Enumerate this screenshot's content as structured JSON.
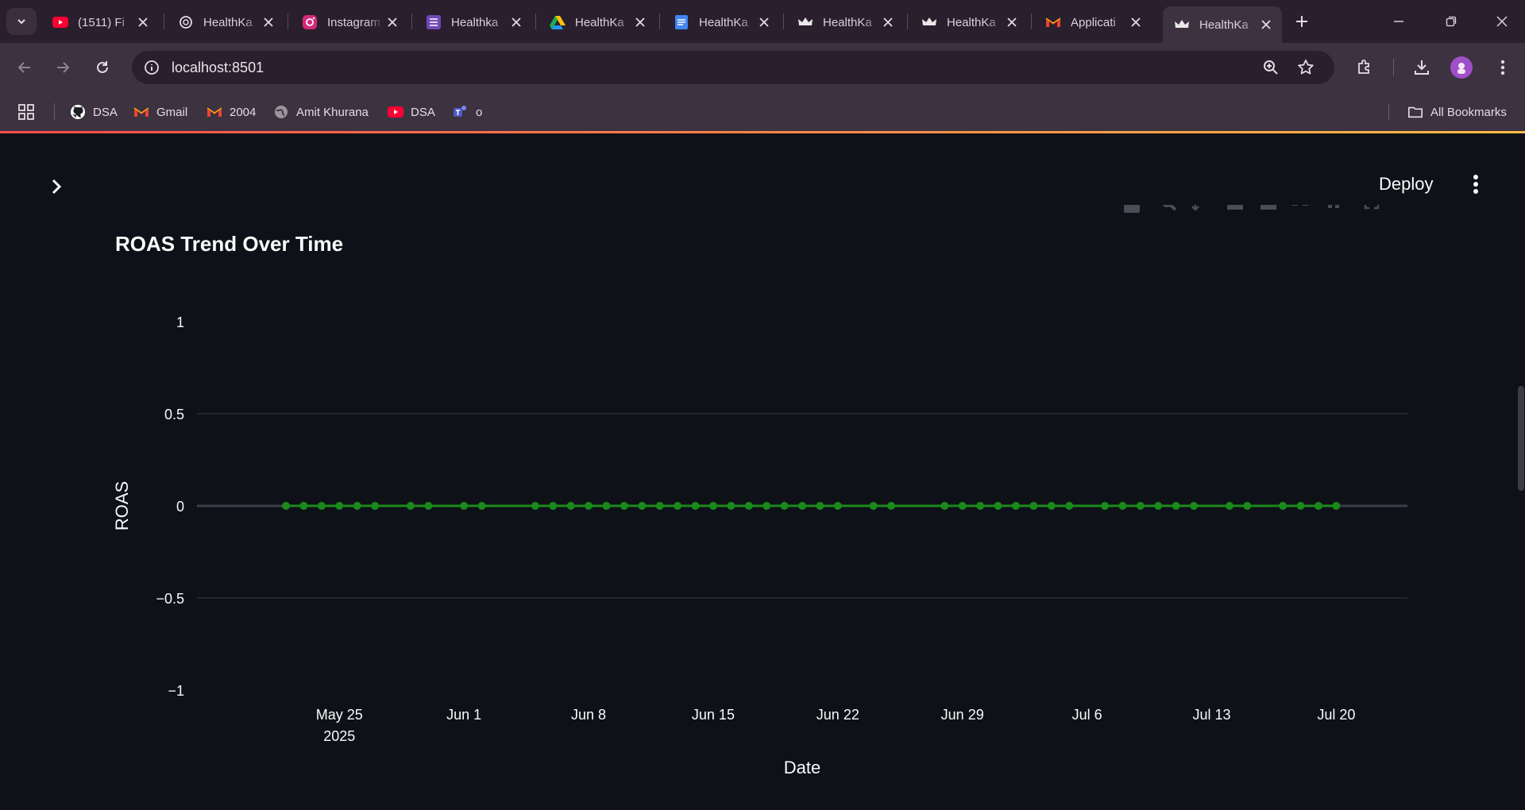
{
  "browser": {
    "tabs": [
      {
        "title": "(1511) Fi",
        "icon": "youtube-icon",
        "active": false
      },
      {
        "title": "HealthKa",
        "icon": "openai-icon",
        "active": false
      },
      {
        "title": "Instagram",
        "icon": "instagram-icon",
        "active": false
      },
      {
        "title": "Healthka",
        "icon": "forms-icon",
        "active": false
      },
      {
        "title": "HealthKa",
        "icon": "google-drive-icon",
        "active": false
      },
      {
        "title": "HealthKa",
        "icon": "google-docs-icon",
        "active": false
      },
      {
        "title": "HealthKa",
        "icon": "streamlit-crown-icon",
        "active": false
      },
      {
        "title": "HealthKa",
        "icon": "streamlit-crown-icon",
        "active": false
      },
      {
        "title": "Applicati",
        "icon": "gmail-icon",
        "active": false
      },
      {
        "title": "HealthKa",
        "icon": "streamlit-crown-icon",
        "active": true
      }
    ],
    "url": "localhost:8501",
    "bookmarks": [
      {
        "label": "DSA",
        "icon": "github-icon"
      },
      {
        "label": "Gmail",
        "icon": "gmail-icon"
      },
      {
        "label": "2004",
        "icon": "gmail-icon"
      },
      {
        "label": "Amit Khurana",
        "icon": "globe-icon"
      },
      {
        "label": "DSA",
        "icon": "youtube-icon"
      },
      {
        "label": "o",
        "icon": "teams-icon"
      }
    ],
    "all_bookmarks_label": "All Bookmarks"
  },
  "app": {
    "deploy_label": "Deploy"
  },
  "chart_data": {
    "type": "line",
    "title": "ROAS Trend Over Time",
    "xlabel": "Date",
    "ylabel": "ROAS",
    "ylim": [
      -1,
      1
    ],
    "yticks": [
      "1",
      "0.5",
      "0",
      "−0.5",
      "−1"
    ],
    "ytick_values": [
      1,
      0.5,
      0,
      -0.5,
      -1
    ],
    "xticks": [
      {
        "label": "May 25",
        "sublabel": "2025",
        "date": "2025-05-25"
      },
      {
        "label": "Jun 1",
        "date": "2025-06-01"
      },
      {
        "label": "Jun 8",
        "date": "2025-06-08"
      },
      {
        "label": "Jun 15",
        "date": "2025-06-15"
      },
      {
        "label": "Jun 22",
        "date": "2025-06-22"
      },
      {
        "label": "Jun 29",
        "date": "2025-06-29"
      },
      {
        "label": "Jul 6",
        "date": "2025-07-06"
      },
      {
        "label": "Jul 13",
        "date": "2025-07-13"
      },
      {
        "label": "Jul 20",
        "date": "2025-07-20"
      }
    ],
    "xlim": [
      "2025-05-17",
      "2025-07-24"
    ],
    "grid": true,
    "series": [
      {
        "color": "#1a8a1a",
        "x": [
          "2025-05-22",
          "2025-05-23",
          "2025-05-24",
          "2025-05-25",
          "2025-05-26",
          "2025-05-27",
          "2025-05-29",
          "2025-05-30",
          "2025-06-01",
          "2025-06-02",
          "2025-06-05",
          "2025-06-06",
          "2025-06-07",
          "2025-06-08",
          "2025-06-09",
          "2025-06-10",
          "2025-06-11",
          "2025-06-12",
          "2025-06-13",
          "2025-06-14",
          "2025-06-15",
          "2025-06-16",
          "2025-06-17",
          "2025-06-18",
          "2025-06-19",
          "2025-06-20",
          "2025-06-21",
          "2025-06-22",
          "2025-06-24",
          "2025-06-25",
          "2025-06-28",
          "2025-06-29",
          "2025-06-30",
          "2025-07-01",
          "2025-07-02",
          "2025-07-03",
          "2025-07-04",
          "2025-07-05",
          "2025-07-07",
          "2025-07-08",
          "2025-07-09",
          "2025-07-10",
          "2025-07-11",
          "2025-07-12",
          "2025-07-14",
          "2025-07-15",
          "2025-07-17",
          "2025-07-18",
          "2025-07-19",
          "2025-07-20"
        ],
        "y": [
          0,
          0,
          0,
          0,
          0,
          0,
          0,
          0,
          0,
          0,
          0,
          0,
          0,
          0,
          0,
          0,
          0,
          0,
          0,
          0,
          0,
          0,
          0,
          0,
          0,
          0,
          0,
          0,
          0,
          0,
          0,
          0,
          0,
          0,
          0,
          0,
          0,
          0,
          0,
          0,
          0,
          0,
          0,
          0,
          0,
          0,
          0,
          0,
          0,
          0
        ]
      }
    ]
  }
}
